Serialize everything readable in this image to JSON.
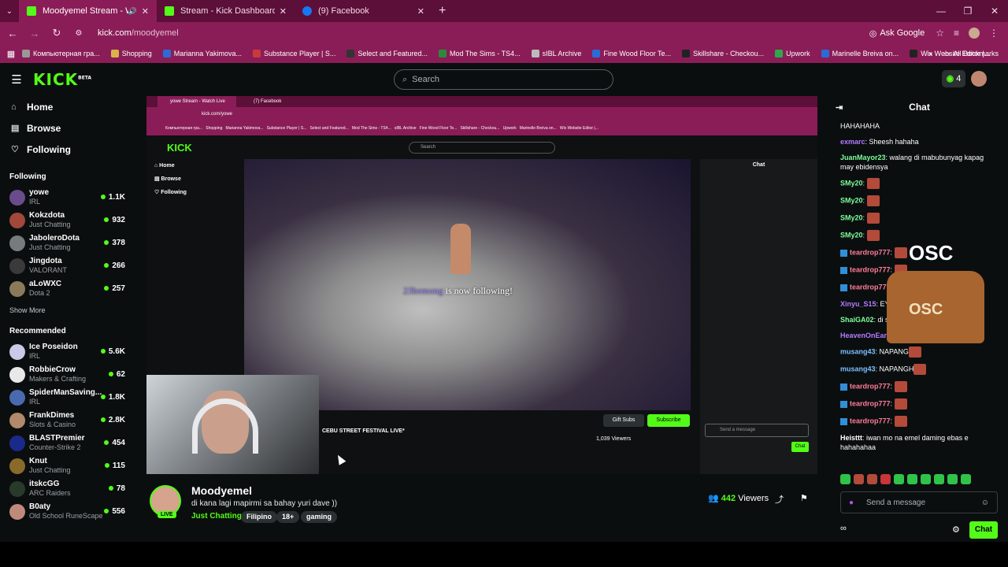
{
  "browser": {
    "tabs": [
      {
        "title": "Moodyemel Stream - Watch",
        "active": true
      },
      {
        "title": "Stream - Kick Dashboard",
        "active": false
      },
      {
        "title": "(9) Facebook",
        "active": false
      }
    ],
    "url_site": "kick.com",
    "url_path": "/moodyemel",
    "ask_google": "Ask Google",
    "bookmarks": [
      "Компьютерная гра...",
      "Shopping",
      "Marianna Yakimova...",
      "Substance Player | S...",
      "Select and Featured...",
      "Mod The Sims - TS4...",
      "sIBL Archive",
      "Fine Wood Floor Te...",
      "Skillshare - Checkou...",
      "Upwork",
      "Marinelle Breiva on...",
      "Wix Website Editor |..."
    ],
    "all_bookmarks": "All Bookmarks"
  },
  "topnav": {
    "logo": "KICK",
    "logo_beta": "BETA",
    "search_placeholder": "Search",
    "kicks": "4"
  },
  "sidebar": {
    "nav": [
      "Home",
      "Browse",
      "Following"
    ],
    "following_title": "Following",
    "following": [
      {
        "name": "yowe",
        "cat": "IRL",
        "viewers": "1.1K",
        "color": "#6a4c8c"
      },
      {
        "name": "Kokzdota",
        "cat": "Just Chatting",
        "viewers": "932",
        "color": "#a0483a"
      },
      {
        "name": "JaboleroDota",
        "cat": "Just Chatting",
        "viewers": "378",
        "color": "#777b7e"
      },
      {
        "name": "Jingdota",
        "cat": "VALORANT",
        "viewers": "266",
        "color": "#3a3a3a"
      },
      {
        "name": "aLoWXC",
        "cat": "Dota 2",
        "viewers": "257",
        "color": "#8a7a5a"
      }
    ],
    "show_more": "Show More",
    "recommended_title": "Recommended",
    "recommended": [
      {
        "name": "Ice Poseidon",
        "cat": "IRL",
        "viewers": "5.6K",
        "color": "#c9c9e8"
      },
      {
        "name": "RobbieCrow",
        "cat": "Makers & Crafting",
        "viewers": "62",
        "color": "#e8e8e8"
      },
      {
        "name": "SpiderManSaving...",
        "cat": "IRL",
        "viewers": "1.8K",
        "color": "#4a6ab0"
      },
      {
        "name": "FrankDimes",
        "cat": "Slots & Casino",
        "viewers": "2.8K",
        "color": "#b08a6a"
      },
      {
        "name": "BLASTPremier",
        "cat": "Counter-Strike 2",
        "viewers": "454",
        "color": "#1a2a8a"
      },
      {
        "name": "Knut",
        "cat": "Just Chatting",
        "viewers": "115",
        "color": "#8a6a2a"
      },
      {
        "name": "itskcGG",
        "cat": "ARC Raiders",
        "viewers": "78",
        "color": "#2a3a2a"
      },
      {
        "name": "B0aty",
        "cat": "Old School RuneScape",
        "viewers": "556",
        "color": "#c08a7a"
      }
    ]
  },
  "player": {
    "follow_user": "23bemong",
    "follow_text": " is now following!",
    "inner_stream_title": "CEBU STREET FESTIVAL LIVE*",
    "inner_viewers": "1,039 Viewers",
    "inner_gift": "Gift Subs",
    "inner_subscribe": "Subscribe",
    "inner_chat_title": "Chat",
    "inner_chat_placeholder": "Send a message",
    "inner_url": "kick.com/yowe",
    "inner_tab1": "yowe Stream - Watch Live",
    "inner_tab2": "(7) Facebook"
  },
  "stream": {
    "name": "Moodyemel",
    "title": "di kana lagi mapirmi sa bahay yuri dave ))",
    "category": "Just Chatting",
    "tags": [
      "Filipino",
      "18+",
      "gaming"
    ],
    "viewers": "442",
    "viewers_label": "Viewers",
    "live": "LIVE"
  },
  "chat": {
    "title": "Chat",
    "messages": [
      {
        "user": "",
        "text": "HAHAHAHA",
        "color": "#ffffff",
        "emote": false,
        "badge": false
      },
      {
        "user": "exmarc",
        "text": "Sheesh hahaha",
        "color": "#b07cff",
        "emote": false,
        "badge": false
      },
      {
        "user": "JuanMayor23",
        "text": "walang di mabubunyag kapag may ebidensya",
        "color": "#7cff9a",
        "emote": false,
        "badge": false
      },
      {
        "user": "SMy20",
        "text": "",
        "color": "#7cff9a",
        "emote": true,
        "badge": false
      },
      {
        "user": "SMy20",
        "text": "",
        "color": "#7cff9a",
        "emote": true,
        "badge": false
      },
      {
        "user": "SMy20",
        "text": "",
        "color": "#7cff9a",
        "emote": true,
        "badge": false
      },
      {
        "user": "SMy20",
        "text": "",
        "color": "#7cff9a",
        "emote": true,
        "badge": false
      },
      {
        "user": "teardrop777",
        "text": "",
        "color": "#ff7c9a",
        "emote": true,
        "badge": true
      },
      {
        "user": "teardrop777",
        "text": "",
        "color": "#ff7c9a",
        "emote": true,
        "badge": true
      },
      {
        "user": "teardrop777",
        "text": "",
        "color": "#ff7c9a",
        "emote": true,
        "badge": true
      },
      {
        "user": "Xinyu_S15",
        "text": "EYE TO",
        "color": "#b07cff",
        "emote": false,
        "badge": false
      },
      {
        "user": "ShaiGA02",
        "text": "di sir",
        "color": "#7cff9a",
        "emote": false,
        "badge": false
      },
      {
        "user": "HeavenOnEar",
        "text": "",
        "color": "#b07cff",
        "emote": false,
        "badge": false
      },
      {
        "user": "musang43",
        "text": "NAPANG",
        "color": "#7cc0ff",
        "emote": true,
        "badge": false
      },
      {
        "user": "musang43",
        "text": "NAPANGH",
        "color": "#7cc0ff",
        "emote": true,
        "badge": false
      },
      {
        "user": "teardrop777",
        "text": "",
        "color": "#ff7c9a",
        "emote": true,
        "badge": true
      },
      {
        "user": "teardrop777",
        "text": "",
        "color": "#ff7c9a",
        "emote": true,
        "badge": true
      },
      {
        "user": "teardrop777",
        "text": "",
        "color": "#ff7c9a",
        "emote": true,
        "badge": true
      },
      {
        "user": "Heisttt",
        "text": "iwan mo na emel daming ebas e hahahahaa",
        "color": "#ffffff",
        "emote": false,
        "badge": false
      }
    ],
    "placeholder": "Send a message",
    "chat_button": "Chat",
    "promo_logo": "OSC"
  },
  "colors": {
    "accent": "#53fc18",
    "browser": "#8a1d57"
  }
}
